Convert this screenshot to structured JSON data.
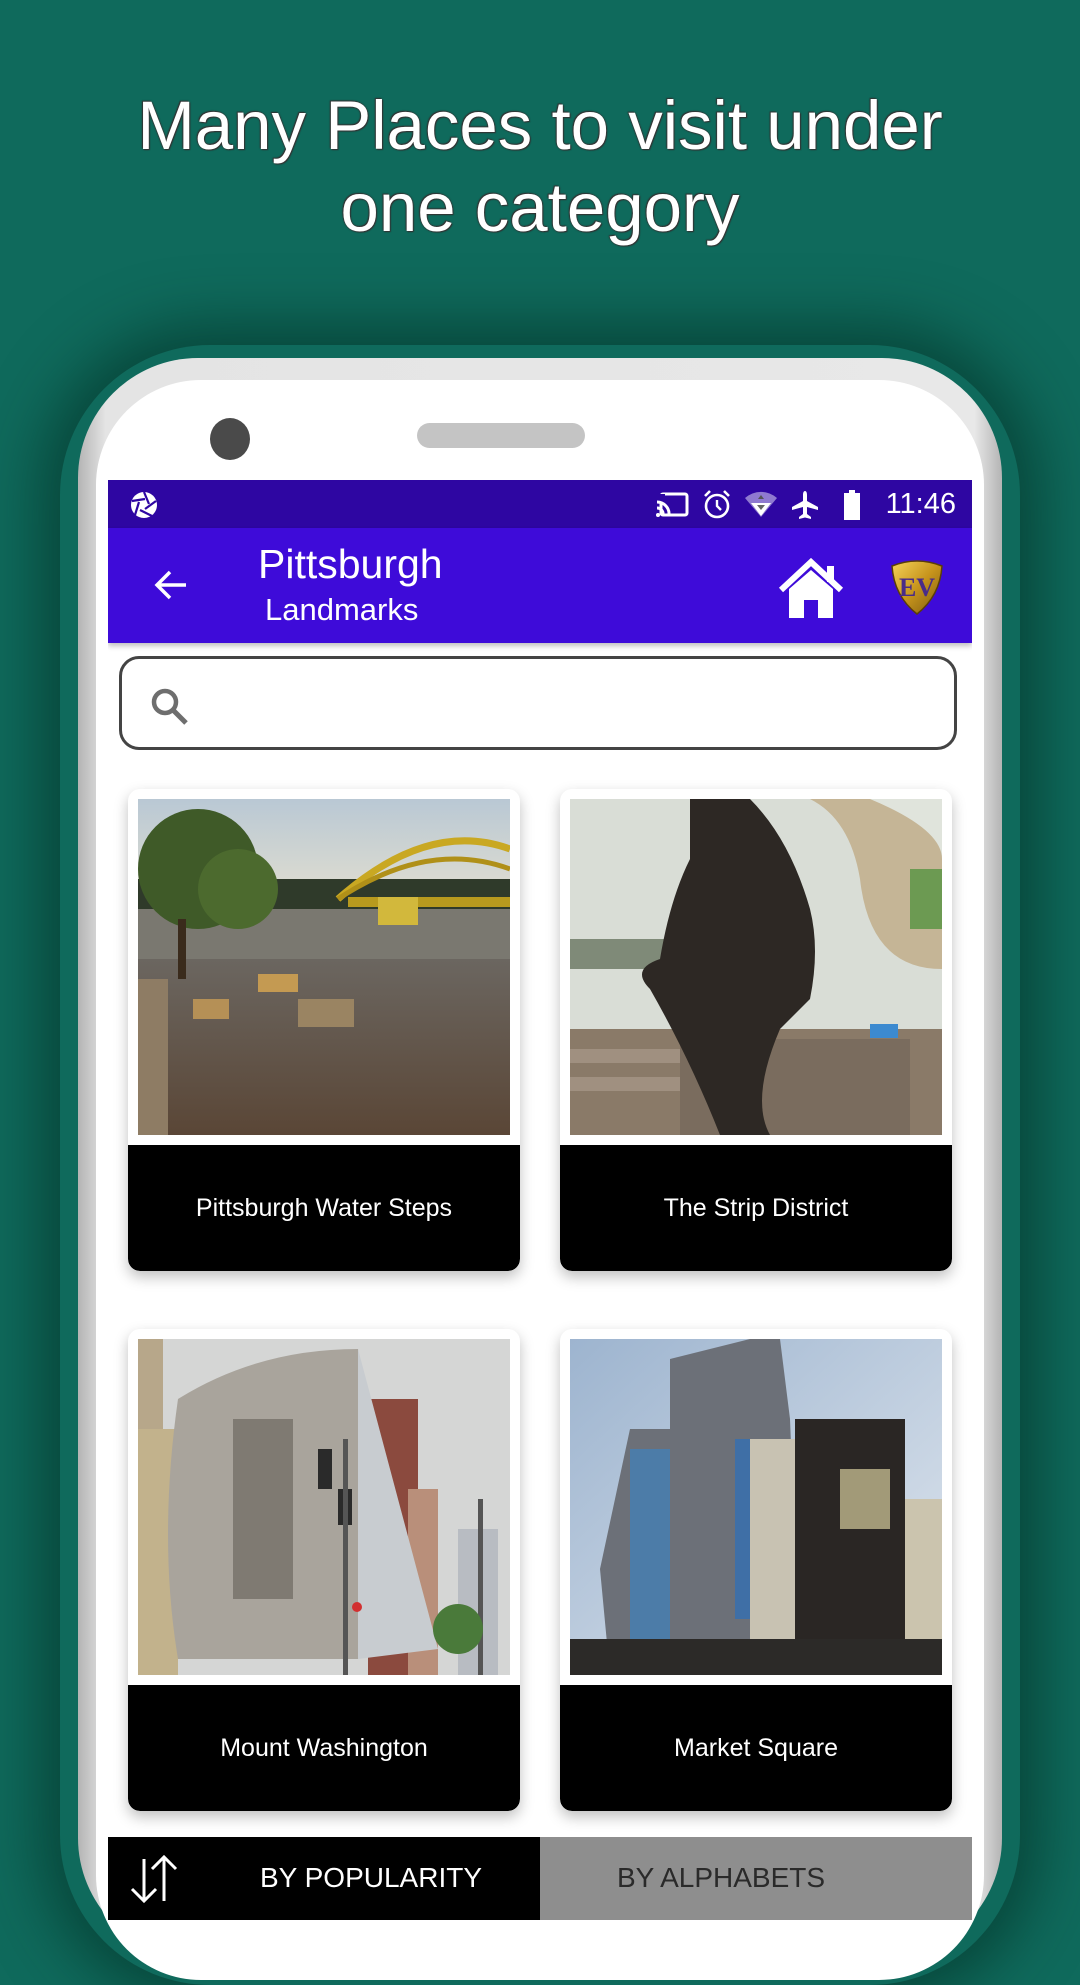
{
  "promo": {
    "headline_line1": "Many Places to visit under",
    "headline_line2": "one category"
  },
  "status_bar": {
    "left_icon": "aperture-icon",
    "icons": [
      "cast-icon",
      "alarm-icon",
      "wifi-icon",
      "airplane-mode-icon",
      "battery-icon"
    ],
    "time": "11:46"
  },
  "app_bar": {
    "title": "Pittsburgh",
    "subtitle": "Landmarks",
    "back_icon": "arrow-left-icon",
    "home_icon": "home-icon",
    "logo_text": "EV"
  },
  "search": {
    "placeholder": "",
    "value": ""
  },
  "places": [
    {
      "name": "Pittsburgh Water Steps"
    },
    {
      "name": "The Strip District"
    },
    {
      "name": "Mount Washington"
    },
    {
      "name": "Market Square"
    }
  ],
  "sort_tabs": {
    "active": "BY POPULARITY",
    "popularity_label": "BY POPULARITY",
    "alphabets_label": "BY ALPHABETS"
  },
  "colors": {
    "background": "#0f6a5c",
    "status_bar": "#2e06a2",
    "app_bar": "#3e0bd9",
    "active_tab": "#000000",
    "inactive_tab": "#8e8e8e"
  }
}
